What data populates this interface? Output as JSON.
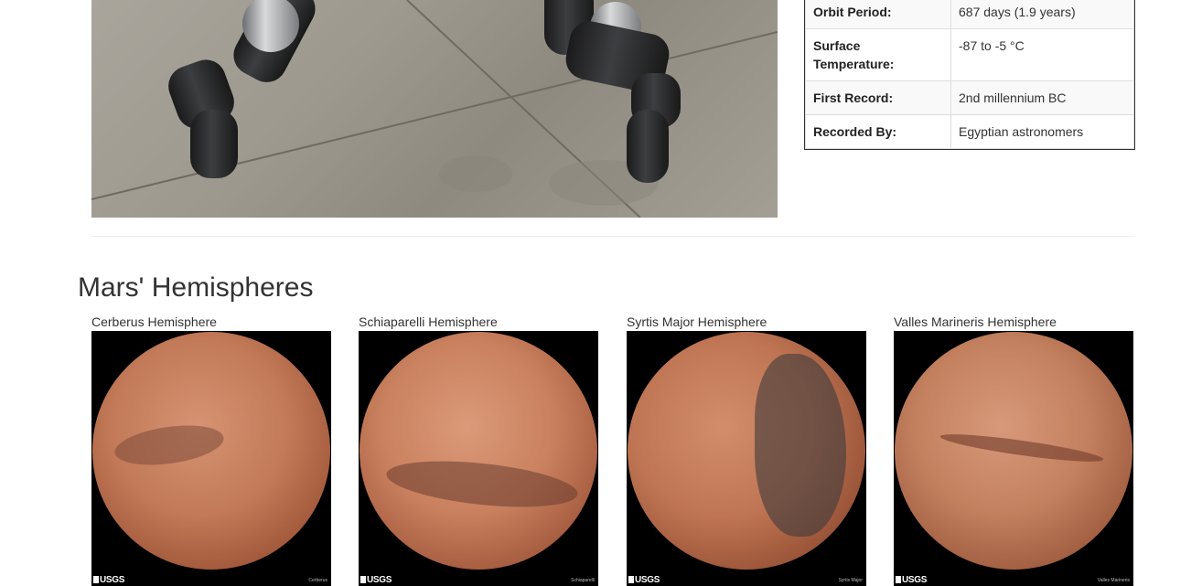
{
  "facts": [
    {
      "label": "Orbit Period:",
      "value": "687 days (1.9 years)"
    },
    {
      "label": "Surface Temperature:",
      "value": "-87 to -5 °C"
    },
    {
      "label": "First Record:",
      "value": "2nd millennium BC"
    },
    {
      "label": "Recorded By:",
      "value": "Egyptian astronomers"
    }
  ],
  "hemispheres_section": {
    "title": "Mars' Hemispheres",
    "items": [
      {
        "title": "Cerberus Hemisphere",
        "watermark": "USGS",
        "image_label": "Cerberus"
      },
      {
        "title": "Schiaparelli Hemisphere",
        "watermark": "USGS",
        "image_label": "Schiaparelli"
      },
      {
        "title": "Syrtis Major Hemisphere",
        "watermark": "USGS",
        "image_label": "Syrtis Major"
      },
      {
        "title": "Valles Marineris Hemisphere",
        "watermark": "USGS",
        "image_label": "Valles Marineris"
      }
    ]
  },
  "colors": {
    "planet_base": "#c0714f",
    "planet_shadow": "#5a2d1f",
    "background": "#ffffff",
    "border": "#dddddd"
  }
}
